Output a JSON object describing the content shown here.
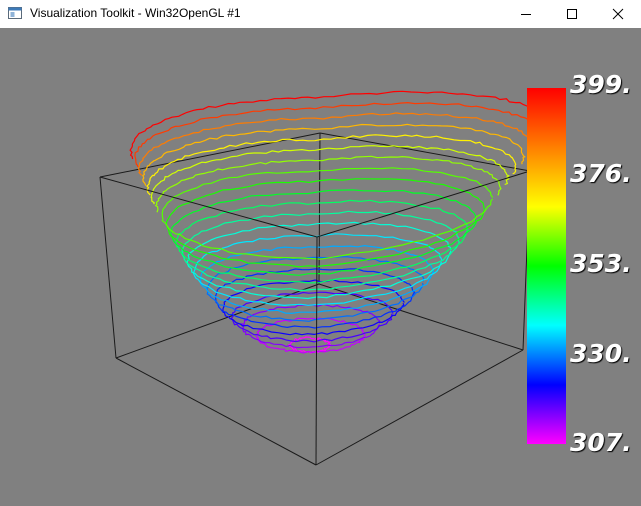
{
  "window": {
    "title": "Visualization Toolkit - Win32OpenGL #1",
    "icons": {
      "app": "vtk-app-icon",
      "minimize": "minimize-icon",
      "maximize": "maximize-icon",
      "close": "close-icon"
    }
  },
  "viewport": {
    "background": "#808080",
    "scalar_bar": {
      "labels": [
        "399.",
        "376.",
        "353.",
        "330.",
        "307."
      ],
      "range": [
        307,
        399
      ]
    },
    "contours": {
      "count": 22
    }
  }
}
